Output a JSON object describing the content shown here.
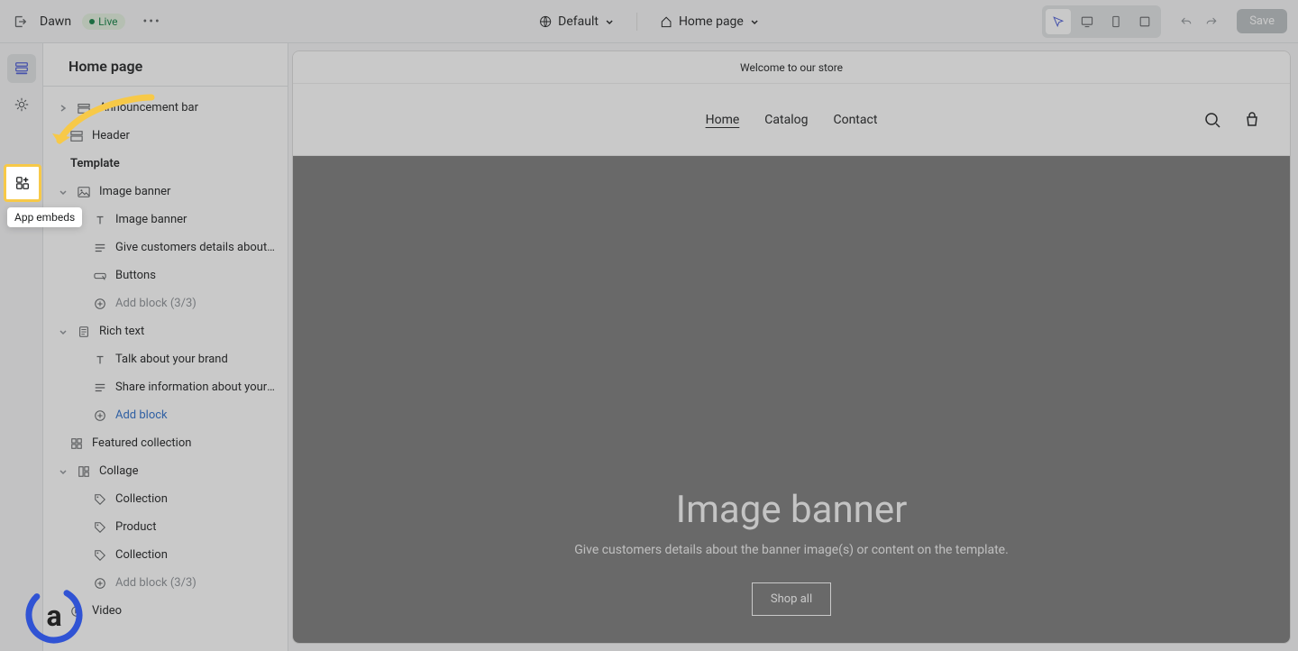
{
  "topbar": {
    "theme_name": "Dawn",
    "live_label": "Live",
    "default_label": "Default",
    "page_label": "Home page",
    "save_label": "Save"
  },
  "tooltip": {
    "app_embeds": "App embeds"
  },
  "sidebar": {
    "title": "Home page",
    "template_label": "Template",
    "items": {
      "announcement_bar": "Announcement bar",
      "header": "Header",
      "image_banner": "Image banner",
      "image_banner_child": "Image banner",
      "give_customers": "Give customers details about the...",
      "buttons": "Buttons",
      "add_block_33": "Add block (3/3)",
      "rich_text": "Rich text",
      "talk_brand": "Talk about your brand",
      "share_info": "Share information about your bra...",
      "add_block": "Add block",
      "featured_collection": "Featured collection",
      "collage": "Collage",
      "collection": "Collection",
      "product": "Product",
      "video": "Video"
    }
  },
  "preview": {
    "announcement": "Welcome to our store",
    "nav": {
      "home": "Home",
      "catalog": "Catalog",
      "contact": "Contact"
    },
    "banner": {
      "title": "Image banner",
      "subtitle": "Give customers details about the banner image(s) or content on the template.",
      "button": "Shop all"
    }
  }
}
